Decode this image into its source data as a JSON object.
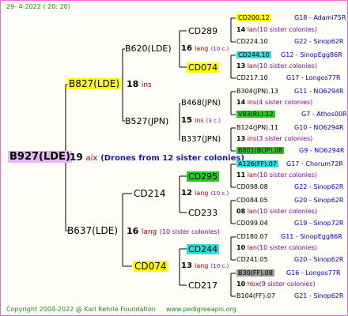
{
  "header": {
    "date": "29- 4-2022 ( 20: 20)"
  },
  "footer": {
    "copyright": "Copyright 2004-2022 @ Karl Kehrle Foundation",
    "website": "www.pedigreeapis.org"
  },
  "root": {
    "name": "B927(LDE)",
    "count": "19",
    "unit": "aix",
    "note": "(Drones from 12 sister colonies)"
  },
  "gen1": [
    {
      "name": "B827(LDE)",
      "count": "18",
      "unit": "ins",
      "note": ""
    },
    {
      "name": "B637(LDE)",
      "count": "16",
      "unit": "lang",
      "note": "(10 sister colonies)"
    }
  ],
  "gen2": [
    {
      "name": "B620(LDE)",
      "count": "16",
      "unit": "lang",
      "note": "(10 c.)"
    },
    {
      "name": "B527(JPN)",
      "count": "15",
      "unit": "ins",
      "note": "(3 c.)"
    },
    {
      "name": "CD214",
      "count": "12",
      "unit": "lang",
      "note": "(10 c.)"
    },
    {
      "name": "CD074",
      "count": "13",
      "unit": "lang",
      "note": "(10 c.)"
    }
  ],
  "gen3": [
    {
      "name": "CD289"
    },
    {
      "name": "CD074"
    },
    {
      "name": "B468(JPN)"
    },
    {
      "name": "B337(JPN)"
    },
    {
      "name": "CD295"
    },
    {
      "name": "CD233"
    },
    {
      "name": "CD244"
    },
    {
      "name": "CD217"
    }
  ],
  "gen4": [
    {
      "name": "CD200.12",
      "count": "",
      "unit": "",
      "note": "",
      "ref": "G18 - Adami75R"
    },
    {
      "name": "",
      "count": "14",
      "unit": "lan",
      "note": "(10 sister colonies)",
      "ref": ""
    },
    {
      "name": "CD224.10",
      "count": "",
      "unit": "",
      "note": "",
      "ref": "G22 - Sinop62R"
    },
    {
      "name": "CD244.10",
      "count": "",
      "unit": "",
      "note": "",
      "ref": "G12 - SinopEgg86R"
    },
    {
      "name": "",
      "count": "13",
      "unit": "lan",
      "note": "(10 sister colonies)",
      "ref": ""
    },
    {
      "name": "CD217.10",
      "count": "",
      "unit": "",
      "note": "",
      "ref": "G17 - Longos77R"
    },
    {
      "name": "B304(JPN).13",
      "count": "",
      "unit": "",
      "note": "",
      "ref": "G11 - NO6294R"
    },
    {
      "name": "",
      "count": "14",
      "unit": "ins",
      "note": "(4 sister colonies)",
      "ref": ""
    },
    {
      "name": "V83(RL).12",
      "count": "",
      "unit": "",
      "note": "",
      "ref": "G7 - Athos00R"
    },
    {
      "name": "B124(JPN).11",
      "count": "",
      "unit": "",
      "note": "",
      "ref": "G10 - NO6294R"
    },
    {
      "name": "",
      "count": "13",
      "unit": "ins",
      "note": "(3 sister colonies)",
      "ref": ""
    },
    {
      "name": "B801(BOP).08",
      "count": "",
      "unit": "",
      "note": "",
      "ref": "G9 - NO6294R"
    },
    {
      "name": "A126(FF).07",
      "count": "",
      "unit": "",
      "note": "",
      "ref": "G17 - Chorum72R"
    },
    {
      "name": "",
      "count": "11",
      "unit": "lan",
      "note": "(10 sister colonies)",
      "ref": ""
    },
    {
      "name": "CD098.08",
      "count": "",
      "unit": "",
      "note": "",
      "ref": "G22 - Sinop62R"
    },
    {
      "name": "CD084.05",
      "count": "",
      "unit": "",
      "note": "",
      "ref": "G20 - Sinop62R"
    },
    {
      "name": "",
      "count": "08",
      "unit": "lan",
      "note": "(10 sister colonies)",
      "ref": ""
    },
    {
      "name": "CD099.04",
      "count": "",
      "unit": "",
      "note": "",
      "ref": "G19 - Sinop72R"
    },
    {
      "name": "CD180.07",
      "count": "",
      "unit": "",
      "note": "",
      "ref": "G11 - SinopEgg86R"
    },
    {
      "name": "",
      "count": "10",
      "unit": "lan",
      "note": "(10 sister colonies)",
      "ref": ""
    },
    {
      "name": "CD241.05",
      "count": "",
      "unit": "",
      "note": "",
      "ref": "G20 - Sinop62R"
    },
    {
      "name": "B30(FF).08",
      "count": "",
      "unit": "",
      "note": "",
      "ref": "G16 - Longos77R"
    },
    {
      "name": "",
      "count": "10",
      "unit": "hbx",
      "note": "(9 sister colonies)",
      "ref": ""
    },
    {
      "name": "B104(FF).07",
      "count": "",
      "unit": "",
      "note": "",
      "ref": "G21 - Sinop62R"
    }
  ],
  "colors": {
    "border": "#ff66cc",
    "yellow": "#ffff00",
    "cyan": "#33dddd",
    "green": "#22cc22",
    "violet": "#e4b8ef",
    "grey": "#999999",
    "navy": "#1a1a99",
    "red": "#aa0000"
  }
}
